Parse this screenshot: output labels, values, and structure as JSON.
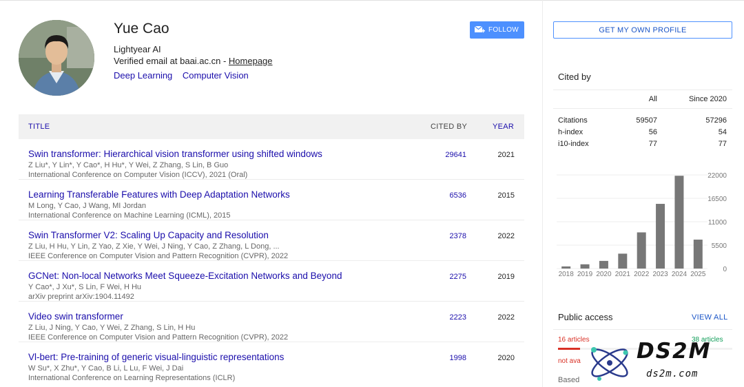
{
  "profile": {
    "name": "Yue Cao",
    "affiliation": "Lightyear AI",
    "email_text": "Verified email at baai.ac.cn - ",
    "homepage_label": "Homepage",
    "interests": [
      "Deep Learning",
      "Computer Vision"
    ],
    "follow_label": "FOLLOW"
  },
  "sidebar": {
    "own_profile_label": "GET MY OWN PROFILE",
    "cited_by_title": "Cited by",
    "stats_header": {
      "all": "All",
      "since": "Since 2020"
    },
    "stats": [
      {
        "label": "Citations",
        "all": "59507",
        "since": "57296"
      },
      {
        "label": "h-index",
        "all": "56",
        "since": "54"
      },
      {
        "label": "i10-index",
        "all": "77",
        "since": "77"
      }
    ],
    "public_access": {
      "title": "Public access",
      "view_all": "VIEW ALL",
      "unavailable": "16 articles",
      "available": "38 articles",
      "not_available": "not ava",
      "based": "Based"
    }
  },
  "chart_data": {
    "type": "bar",
    "categories": [
      "2018",
      "2019",
      "2020",
      "2021",
      "2022",
      "2023",
      "2024",
      "2025"
    ],
    "values": [
      500,
      1000,
      1800,
      3500,
      8500,
      15200,
      21800,
      6800
    ],
    "yticks": [
      "22000",
      "16500",
      "11000",
      "5500",
      "0"
    ],
    "ylim": [
      0,
      22000
    ],
    "bar_color": "#777777"
  },
  "table": {
    "headers": {
      "title": "TITLE",
      "cited_by": "CITED BY",
      "year": "YEAR"
    },
    "rows": [
      {
        "title": "Swin transformer: Hierarchical vision transformer using shifted windows",
        "authors": "Z Liu*, Y Lin*, Y Cao*, H Hu*, Y Wei, Z Zhang, S Lin, B Guo",
        "venue": "International Conference on Computer Vision (ICCV), 2021 (Oral)",
        "cited": "29641",
        "year": "2021"
      },
      {
        "title": "Learning Transferable Features with Deep Adaptation Networks",
        "authors": "M Long, Y Cao, J Wang, MI Jordan",
        "venue": "International Conference on Machine Learning (ICML), 2015",
        "cited": "6536",
        "year": "2015"
      },
      {
        "title": "Swin Transformer V2: Scaling Up Capacity and Resolution",
        "authors": "Z Liu, H Hu, Y Lin, Z Yao, Z Xie, Y Wei, J Ning, Y Cao, Z Zhang, L Dong, ...",
        "venue": "IEEE Conference on Computer Vision and Pattern Recognition (CVPR), 2022",
        "cited": "2378",
        "year": "2022"
      },
      {
        "title": "GCNet: Non-local Networks Meet Squeeze-Excitation Networks and Beyond",
        "authors": "Y Cao*, J Xu*, S Lin, F Wei, H Hu",
        "venue": "arXiv preprint arXiv:1904.11492",
        "cited": "2275",
        "year": "2019"
      },
      {
        "title": "Video swin transformer",
        "authors": "Z Liu, J Ning, Y Cao, Y Wei, Z Zhang, S Lin, H Hu",
        "venue": "IEEE Conference on Computer Vision and Pattern Recognition (CVPR), 2022",
        "cited": "2223",
        "year": "2022"
      },
      {
        "title": "Vl-bert: Pre-training of generic visual-linguistic representations",
        "authors": "W Su*, X Zhu*, Y Cao, B Li, L Lu, F Wei, J Dai",
        "venue": "International Conference on Learning Representations (ICLR)",
        "cited": "1998",
        "year": "2020"
      }
    ]
  },
  "watermark": {
    "main": "DS2M",
    "sub": "ds2m.com"
  },
  "colors": {
    "link": "#1a0dab",
    "accent": "#4d90fe",
    "bar": "#777777",
    "red": "#d93025",
    "green": "#0f9d58"
  }
}
